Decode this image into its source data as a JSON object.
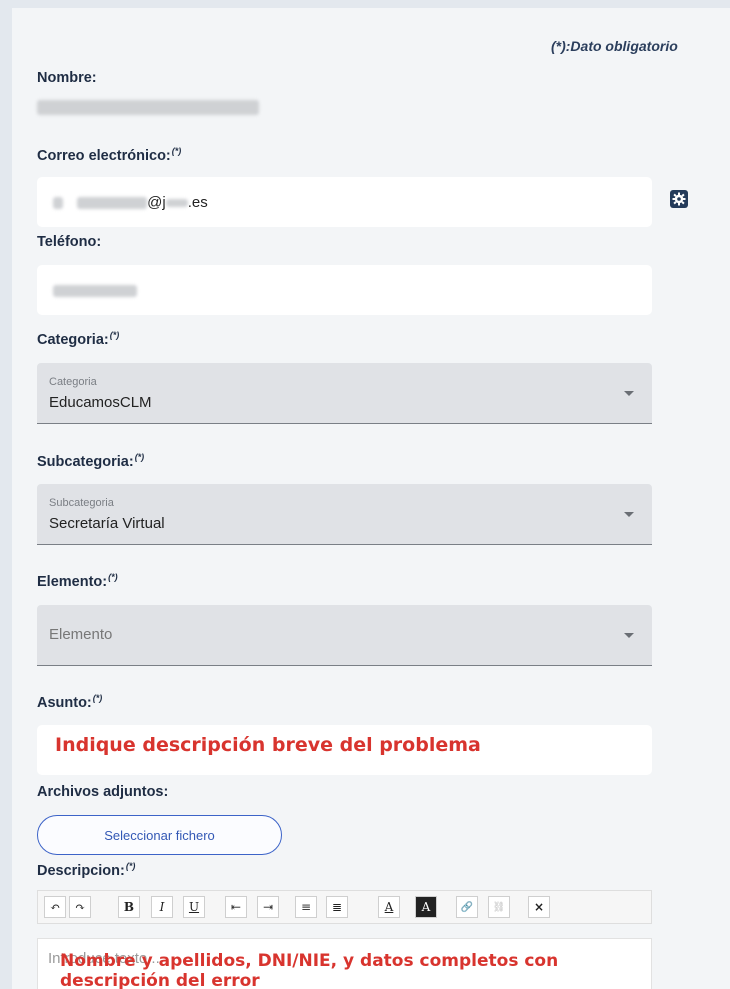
{
  "required_note": "(*):Dato obligatorio",
  "required_mark": "(*)",
  "fields": {
    "nombre": {
      "label": "Nombre:"
    },
    "correo": {
      "label": "Correo electrónico:",
      "value_domain": "@j",
      "value_tld": ".es"
    },
    "telefono": {
      "label": "Teléfono:"
    },
    "categoria": {
      "label": "Categoria:",
      "floating_label": "Categoria",
      "value": "EducamosCLM"
    },
    "subcategoria": {
      "label": "Subcategoria:",
      "floating_label": "Subcategoria",
      "value": "Secretaría Virtual"
    },
    "elemento": {
      "label": "Elemento:",
      "placeholder": "Elemento"
    },
    "asunto": {
      "label": "Asunto:",
      "hint": "Indique descripción breve del problema"
    },
    "adjuntos": {
      "label": "Archivos adjuntos:",
      "button": "Seleccionar fichero"
    },
    "descripcion": {
      "label": "Descripcion:",
      "placeholder": "Introduce texto...",
      "note_line1": "Nombre y apellidos, DNI/NIE, y datos completos con",
      "note_line2": "descripción del error"
    }
  },
  "toolbar": {
    "undo": "↶",
    "redo": "↷",
    "bold": "B",
    "italic": "I",
    "underline": "U",
    "outdent": "⇤",
    "indent": "⇥",
    "bullet_list": "≡",
    "numbered_list": "≣",
    "text_color": "A",
    "bg_color": "A",
    "link": "🔗",
    "unlink": "⛓",
    "clear": "×"
  },
  "colors": {
    "accent": "#3c63c8",
    "label": "#1f2d44",
    "hint_red": "#d8342e"
  }
}
